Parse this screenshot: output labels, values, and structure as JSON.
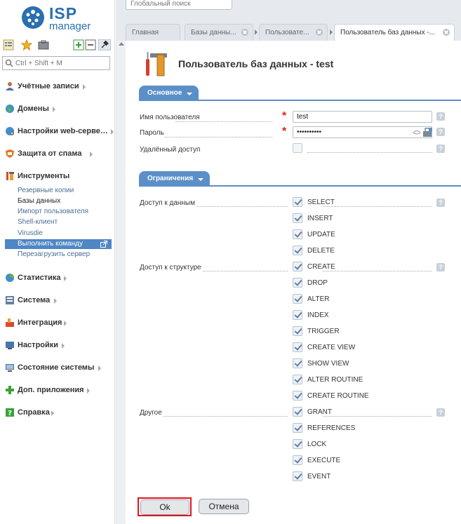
{
  "app": {
    "logo_top": "ISP",
    "logo_bottom": "manager",
    "global_search_placeholder": "Глобальный поиск"
  },
  "sidebar": {
    "search_placeholder": "Ctrl + Shift + M",
    "sections": [
      {
        "label": "Учётные записи",
        "icon": "user-icon"
      },
      {
        "label": "Домены",
        "icon": "globe-icon"
      },
      {
        "label": "Настройки web-серве…",
        "icon": "web-settings-icon"
      },
      {
        "label": "Защита от спама",
        "icon": "shield-icon"
      },
      {
        "label": "Инструменты",
        "icon": "tools-icon"
      },
      {
        "label": "Статистика",
        "icon": "pie-chart-icon"
      },
      {
        "label": "Система",
        "icon": "system-icon"
      },
      {
        "label": "Интеграция",
        "icon": "integration-icon"
      },
      {
        "label": "Настройки",
        "icon": "settings-icon"
      },
      {
        "label": "Состояние системы",
        "icon": "monitor-icon"
      },
      {
        "label": "Доп. приложения",
        "icon": "plus-icon"
      },
      {
        "label": "Справка",
        "icon": "help-icon"
      }
    ],
    "tools_items": [
      "Резервные копии",
      "Базы данных",
      "Импорт пользователя",
      "Shell-клиент",
      "Virusdie",
      "Выполнить команду",
      "Перезагрузить сервер"
    ]
  },
  "tabs": [
    {
      "label": "Главная"
    },
    {
      "label": "Базы данны..."
    },
    {
      "label": "Пользовате..."
    },
    {
      "label": "Пользователь баз данных -..."
    }
  ],
  "page": {
    "title": "Пользователь баз данных - test"
  },
  "form": {
    "section_main": "Основное",
    "username_label": "Имя пользователя",
    "username_value": "test",
    "password_label": "Пароль",
    "password_value": "••••••••••",
    "remote_label": "Удалённый доступ",
    "section_limits": "Ограничения",
    "group_data": "Доступ к данным",
    "group_structure": "Доступ к структуре",
    "group_other": "Другое",
    "privileges": [
      "SELECT",
      "INSERT",
      "UPDATE",
      "DELETE",
      "CREATE",
      "DROP",
      "ALTER",
      "INDEX",
      "TRIGGER",
      "CREATE VIEW",
      "SHOW VIEW",
      "ALTER ROUTINE",
      "CREATE ROUTINE",
      "GRANT",
      "REFERENCES",
      "LOCK",
      "EXECUTE",
      "EVENT"
    ],
    "help_glyph": "?",
    "required_glyph": "*"
  },
  "buttons": {
    "ok": "Ok",
    "cancel": "Отмена"
  },
  "colors": {
    "accent": "#5a8fc8",
    "selected_nav": "#4f86c4",
    "highlight_frame": "#e0161e"
  }
}
